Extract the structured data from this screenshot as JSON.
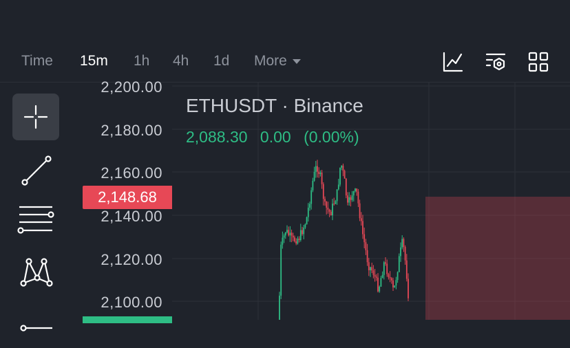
{
  "toolbar": {
    "timeframes": [
      "Time",
      "15m",
      "1h",
      "4h",
      "1d"
    ],
    "active_timeframe": "15m",
    "more_label": "More",
    "right_icons": [
      "indicators-icon",
      "chart-settings-icon",
      "layout-grid-icon"
    ]
  },
  "tools": [
    "crosshair-icon",
    "trendline-icon",
    "horizontal-lines-icon",
    "pattern-icon",
    "ruler-icon"
  ],
  "price_axis": {
    "labels": [
      "2,200.00",
      "2,180.00",
      "2,160.00",
      "2,140.00",
      "2,120.00",
      "2,100.00"
    ],
    "current_price": "2,148.68"
  },
  "chart": {
    "symbol": "ETHUSDT · Binance",
    "last_price": "2,088.30",
    "change": "0.00",
    "change_pct": "(0.00%)",
    "colors": {
      "up": "#2ebd85",
      "down": "#e74856",
      "background": "#1f232b",
      "grid": "#2c3038"
    }
  }
}
